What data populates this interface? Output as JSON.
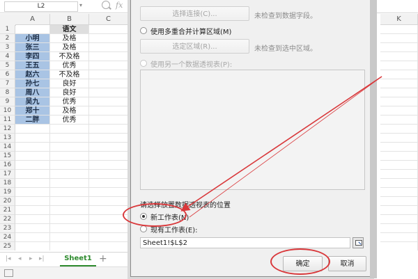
{
  "formula_bar": {
    "name_box": "L2",
    "zoom_icon": "magnifier-icon",
    "fx_label": "fx"
  },
  "spreadsheet": {
    "columns": [
      "A",
      "B",
      "C",
      "K"
    ],
    "rows": [
      "1",
      "2",
      "3",
      "4",
      "5",
      "6",
      "7",
      "8",
      "9",
      "10",
      "11",
      "12",
      "13",
      "14",
      "15",
      "16",
      "17",
      "18",
      "19",
      "20",
      "21",
      "22",
      "23",
      "24",
      "25"
    ],
    "header_b1": "语文",
    "data": [
      {
        "name": "小明",
        "grade": "及格"
      },
      {
        "name": "张三",
        "grade": "及格"
      },
      {
        "name": "李四",
        "grade": "不及格"
      },
      {
        "name": "王五",
        "grade": "优秀"
      },
      {
        "name": "赵六",
        "grade": "不及格"
      },
      {
        "name": "孙七",
        "grade": "良好"
      },
      {
        "name": "周八",
        "grade": "良好"
      },
      {
        "name": "吴九",
        "grade": "优秀"
      },
      {
        "name": "郑十",
        "grade": "及格"
      },
      {
        "name": "二胖",
        "grade": "优秀"
      }
    ],
    "colors": {
      "name_fill": "#a9c4e4",
      "header_fill": "#dedede"
    }
  },
  "sheet_tabs": {
    "active": "Sheet1",
    "add_label": "+"
  },
  "dialog": {
    "choose_connection_button": "选择连接(C)...",
    "no_field_note": "未检查到数据字段。",
    "multi_range_radio": "使用多重合并计算区域(M)",
    "select_region_button": "选定区域(R)...",
    "no_region_note": "未检查到选中区域。",
    "another_pivot_radio": "使用另一个数据透视表(P):",
    "location_heading": "请选择放置数据透视表的位置",
    "new_sheet_radio": "新工作表(N)",
    "existing_sheet_radio": "现有工作表(E):",
    "reference_value": "Sheet1!$L$2",
    "ok_button": "确定",
    "cancel_button": "取消"
  },
  "annotation_color": "#d9383b"
}
